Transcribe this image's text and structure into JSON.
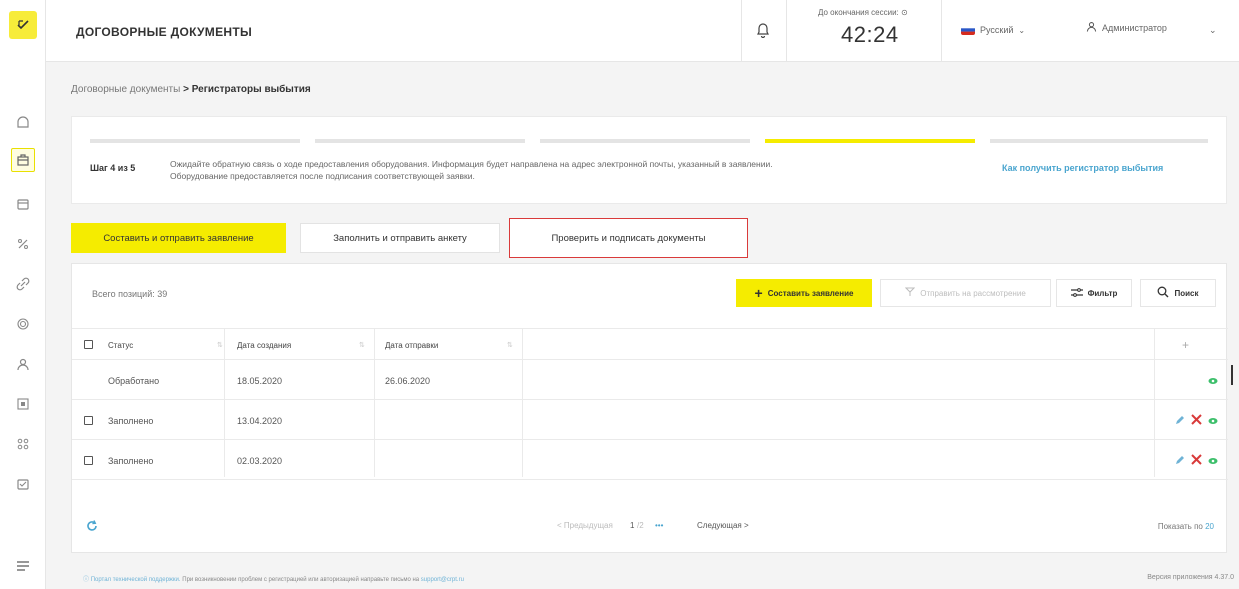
{
  "header": {
    "title": "ДОГОВОРНЫЕ ДОКУМЕНТЫ",
    "session_label": "До окончания сессии:",
    "session_time": "42:24",
    "language": "Русский",
    "user": "Администратор"
  },
  "breadcrumb": {
    "parent": "Договорные документы",
    "separator": ">",
    "current": "Регистраторы выбытия"
  },
  "steps": {
    "step_label": "Шаг 4 из 5",
    "current_step": 4,
    "total_steps": 5,
    "text_line1": "Ожидайте обратную связь о ходе предоставления оборудования. Информация будет направлена на адрес электронной почты, указанный в заявлении.",
    "text_line2": "Оборудование предоставляется после подписания соответствующей заявки.",
    "help_link": "Как получить регистратор выбытия"
  },
  "actions": {
    "compose_send": "Составить и отправить заявление",
    "fill_send": "Заполнить и отправить анкету",
    "check_sign": "Проверить и подписать документы"
  },
  "table": {
    "total": "Всего позиций: 39",
    "toolbar": {
      "compose": "Составить заявление",
      "send_review": "Отправить на рассмотрение",
      "filter": "Фильтр",
      "search": "Поиск"
    },
    "columns": [
      "Статус",
      "Дата создания",
      "Дата отправки"
    ],
    "add_column": "+",
    "rows": [
      {
        "status": "Обработано",
        "created": "18.05.2020",
        "sent": "26.06.2020",
        "has_checkbox": false,
        "actions": [
          "view"
        ]
      },
      {
        "status": "Заполнено",
        "created": "13.04.2020",
        "sent": "",
        "has_checkbox": true,
        "actions": [
          "edit",
          "delete",
          "view"
        ]
      },
      {
        "status": "Заполнено",
        "created": "02.03.2020",
        "sent": "",
        "has_checkbox": true,
        "actions": [
          "edit",
          "delete",
          "view"
        ]
      }
    ],
    "pager": {
      "prev": "< Предыдущая",
      "page": "1",
      "of": "/2",
      "ellipsis": "•••",
      "next": "Следующая >",
      "show_by_label": "Показать по",
      "show_by_value": "20"
    }
  },
  "footer": {
    "support_link": "Портал технической поддержки.",
    "support_text": "При возникновении проблем с регистрацией или авторизацией направьте письмо на",
    "email": "support@crpt.ru",
    "version": "Версия приложения 4.37.0"
  },
  "colors": {
    "accent": "#f5ec00",
    "link": "#4aa5cf",
    "delete": "#d93a3a",
    "view": "#3cbf6b"
  },
  "icons": {
    "sidebar": [
      "logo-icon",
      "home-icon",
      "briefcase-icon",
      "folder-icon",
      "percent-icon",
      "link-icon",
      "fingerprint-icon",
      "person-icon",
      "qr-code-icon",
      "grid-icon",
      "cart-icon",
      "menu-icon"
    ]
  }
}
